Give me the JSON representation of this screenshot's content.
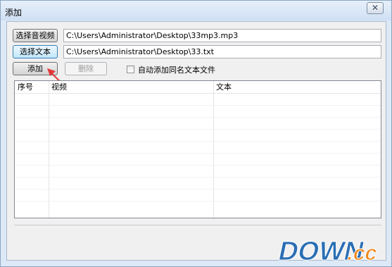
{
  "window": {
    "title": "添加",
    "close_glyph": "✕"
  },
  "buttons": {
    "select_av": "选择音视频",
    "select_text": "选择文本",
    "add": "添加",
    "delete": "删除"
  },
  "fields": {
    "av_path": "C:\\Users\\Administrator\\Desktop\\33mp3.mp3",
    "text_path": "C:\\Users\\Administrator\\Desktop\\33.txt"
  },
  "checkbox": {
    "label": "自动添加同名文本文件",
    "checked": false
  },
  "table": {
    "columns": [
      "序号",
      "视频",
      "文本"
    ],
    "rows": []
  },
  "watermark": {
    "text_main": "DOWN",
    "text_suffix": ".cc"
  },
  "colors": {
    "accent_arrow": "#e0393a",
    "watermark_blue": "#2b6fb5",
    "watermark_orange": "#f08a1c"
  }
}
